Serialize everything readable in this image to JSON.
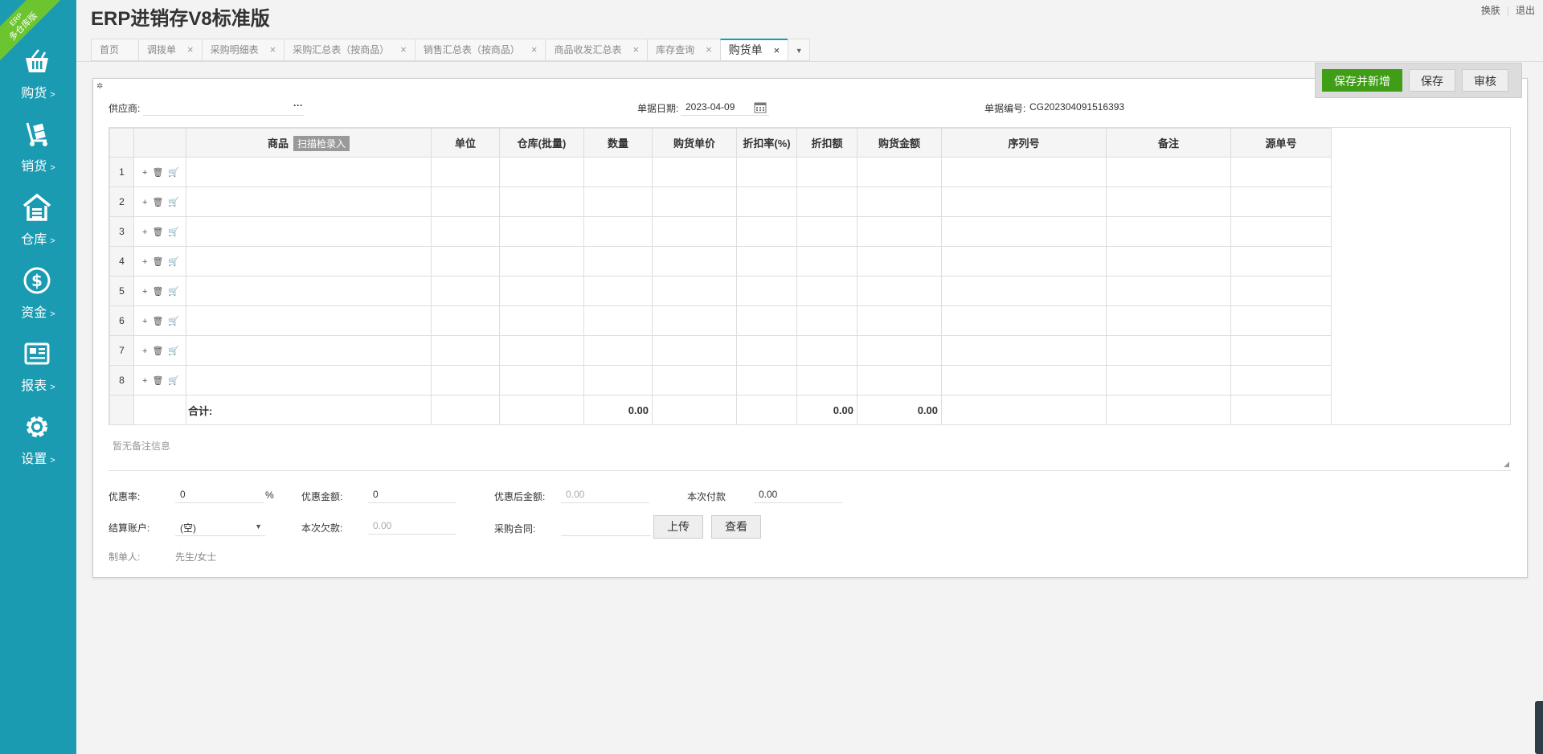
{
  "ribbon": {
    "line1": "ERP",
    "line2": "多仓库版"
  },
  "app_title": "ERP进销存V8标准版",
  "top_links": {
    "skin": "换肤",
    "logout": "退出"
  },
  "sidebar": {
    "items": [
      {
        "label": "购货",
        "arrow": ">",
        "icon": "basket-icon"
      },
      {
        "label": "销货",
        "arrow": ">",
        "icon": "hand-truck-icon"
      },
      {
        "label": "仓库",
        "arrow": ">",
        "icon": "warehouse-icon"
      },
      {
        "label": "资金",
        "arrow": ">",
        "icon": "dollar-icon"
      },
      {
        "label": "报表",
        "arrow": ">",
        "icon": "report-icon"
      },
      {
        "label": "设置",
        "arrow": ">",
        "icon": "gear-icon"
      }
    ]
  },
  "tabs": [
    {
      "label": "首页",
      "closable": false
    },
    {
      "label": "调拨单",
      "closable": true
    },
    {
      "label": "采购明细表",
      "closable": true
    },
    {
      "label": "采购汇总表（按商品）",
      "closable": true
    },
    {
      "label": "销售汇总表（按商品）",
      "closable": true
    },
    {
      "label": "商品收发汇总表",
      "closable": true
    },
    {
      "label": "库存查询",
      "closable": true
    },
    {
      "label": "购货单",
      "closable": true,
      "active": true
    }
  ],
  "tab_close_glyph": "×",
  "actions": {
    "save_new": "保存并新增",
    "save": "保存",
    "audit": "审核"
  },
  "form": {
    "supplier_label": "供应商:",
    "supplier_value": "",
    "supplier_more": "···",
    "date_label": "单据日期:",
    "date_value": "2023-04-09",
    "docno_label": "单据编号:",
    "docno_value": "CG202304091516393"
  },
  "grid": {
    "headers": {
      "product": "商品",
      "scan": "扫描枪录入",
      "unit": "单位",
      "warehouse": "仓库(批量)",
      "qty": "数量",
      "price": "购货单价",
      "disc_rate": "折扣率(%)",
      "disc_amt": "折扣额",
      "amount": "购货金额",
      "serial": "序列号",
      "remark": "备注",
      "source": "源单号"
    },
    "rows": [
      "1",
      "2",
      "3",
      "4",
      "5",
      "6",
      "7",
      "8"
    ],
    "row_ops": {
      "add": "+",
      "delete": "🗑",
      "cart": "🛒"
    },
    "total": {
      "label": "合计:",
      "qty": "0.00",
      "disc_amt": "0.00",
      "amount": "0.00"
    }
  },
  "remark_placeholder": "暂无备注信息",
  "footer": {
    "discount_rate_label": "优惠率:",
    "discount_rate_value": "0",
    "percent": "%",
    "discount_amount_label": "优惠金额:",
    "discount_amount_value": "0",
    "after_discount_label": "优惠后金额:",
    "after_discount_placeholder": "0.00",
    "payment_label": "本次付款",
    "payment_value": "0.00",
    "account_label": "结算账户:",
    "account_value": "(空)",
    "arrears_label": "本次欠款:",
    "arrears_placeholder": "0.00",
    "contract_label": "采购合同:",
    "upload": "上传",
    "view": "查看",
    "maker_label": "制单人:",
    "maker_value": "先生/女士"
  }
}
